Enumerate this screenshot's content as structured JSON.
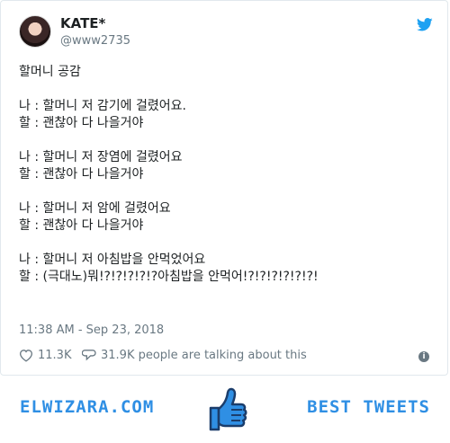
{
  "tweet": {
    "display_name": "KATE*",
    "handle": "@www2735",
    "lines": [
      "할머니 공감",
      "",
      "나 : 할머니 저 감기에 걸렸어요.",
      "할 : 괜찮아 다 나을거야",
      "",
      "나 : 할머니 저 장염에 걸렸어요",
      "할 : 괜찮아 다 나을거야",
      "",
      "나 : 할머니 저 암에 걸렸어요",
      "할 : 괜찮아 다 나을거야",
      "",
      "나 : 할머니 저 아침밥을 안먹었어요",
      "할 : (극대노)뭐!?!?!?!?!?아침밥을 안먹어!?!?!?!?!?!?!"
    ],
    "timestamp": "11:38 AM - Sep 23, 2018",
    "likes": "11.3K",
    "talking": "31.9K people are talking about this",
    "icons": {
      "bird": "twitter-bird-icon",
      "like": "heart-icon",
      "reply": "comment-icon",
      "info": "info-icon"
    },
    "colors": {
      "brand": "#1da1f2",
      "muted": "#697882"
    }
  },
  "banner": {
    "left_text": "ELWIZARA.COM",
    "right_text": "BEST TWEETS",
    "color": "#2f8fe4",
    "icon": "thumbs-up-icon"
  }
}
